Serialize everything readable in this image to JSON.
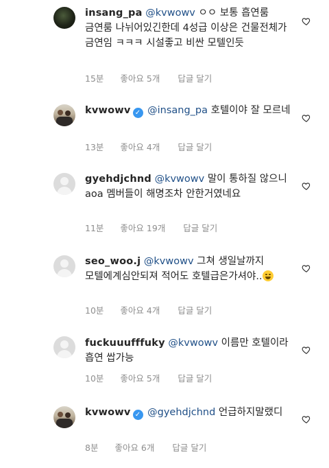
{
  "comments": [
    {
      "username": "insang_pa",
      "verified": false,
      "mention": "@kvwowv",
      "text": "ㅇㅇ 보통 흡연룸 금연룸 나뉘어있긴한데 4성급 이상은 건물전체가 금연임 ㅋㅋㅋ 시설좋고 비싼 모텔인듯",
      "time": "15분",
      "likes": "좋아요 5개",
      "reply": "답글 달기",
      "avatar": "photo-dark"
    },
    {
      "username": "kvwowv",
      "verified": true,
      "mention": "@insang_pa",
      "text": "호텔이야 잘 모르네",
      "time": "13분",
      "likes": "좋아요 4개",
      "reply": "답글 달기",
      "avatar": "photo-people"
    },
    {
      "username": "gyehdjchnd",
      "verified": false,
      "mention": "@kvwowv",
      "text": "말이 통하질 않으니 aoa 멤버들이 해명조차 안한거였네요",
      "time": "11분",
      "likes": "좋아요 19개",
      "reply": "답글 달기",
      "avatar": "default"
    },
    {
      "username": "seo_woo.j",
      "verified": false,
      "mention": "@kvwowv",
      "text": "그쳐 생일날까지 모텔에계심안되져 적어도 호텔급은가셔야..",
      "time": "10분",
      "likes": "좋아요 4개",
      "reply": "답글 달기",
      "avatar": "default"
    },
    {
      "username": "fuckuuufffuky",
      "verified": false,
      "mention": "@kvwowv",
      "text": "이름만 호텔이라 흡연 쌉가능",
      "time": "10분",
      "likes": "좋아요 5개",
      "reply": "답글 달기",
      "avatar": "default"
    },
    {
      "username": "kvwowv",
      "verified": true,
      "mention": "@gyehdjchnd",
      "text": "언급하지말랬디",
      "time": "8분",
      "likes": "좋아요 6개",
      "reply": "답글 달기",
      "avatar": "photo-people"
    }
  ],
  "icons": {
    "like": "heart-outline-icon",
    "verified": "verified-badge-icon",
    "emoji": "grinning-sweat-emoji"
  },
  "colors": {
    "mention": "#1f4f87",
    "meta": "#8e8e8e",
    "verified": "#3897f0"
  }
}
